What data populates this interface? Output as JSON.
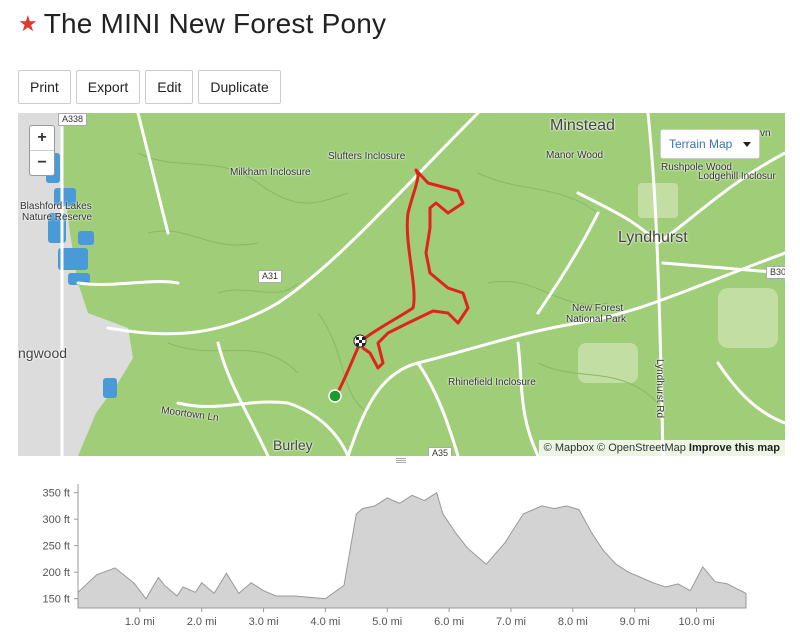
{
  "header": {
    "title": "The MINI New Forest Pony",
    "star_icon": "star-icon"
  },
  "toolbar": {
    "print": "Print",
    "export": "Export",
    "edit": "Edit",
    "duplicate": "Duplicate"
  },
  "map": {
    "zoom_in": "+",
    "zoom_out": "−",
    "layer_select": "Terrain Map",
    "attribution": {
      "mapbox": "© Mapbox",
      "osm": "© OpenStreetMap",
      "improve": "Improve this map"
    },
    "labels": {
      "minstead": "Minstead",
      "manor_wood": "Manor Wood",
      "slufters": "Slufters Inclosure",
      "milkham": "Milkham Inclosure",
      "blashford": "Blashford Lakes",
      "nature_reserve": "Nature Reserve",
      "lyndhurst": "Lyndhurst",
      "rushpole": "Rushpole Wood",
      "lodgehill": "Lodgehill Inclosur",
      "vn": "vn",
      "new_forest": "New Forest",
      "national_park": "National Park",
      "ringwood": "ngwood",
      "rhinefield": "Rhinefield Inclosure",
      "moortown": "Moortown Ln",
      "burley": "Burley",
      "lyndhurst_rd": "Lyndhurst Rd",
      "a338": "A338",
      "a31": "A31",
      "a35": "A35",
      "b30": "B30"
    },
    "colors": {
      "land": "#9fcd78",
      "route": "#e0241b",
      "start": "#1a9b2a"
    }
  },
  "elevation": {
    "y_ticks": [
      "350 ft",
      "300 ft",
      "250 ft",
      "200 ft",
      "150 ft"
    ],
    "x_ticks": [
      "1.0 mi",
      "2.0 mi",
      "3.0 mi",
      "4.0 mi",
      "5.0 mi",
      "6.0 mi",
      "7.0 mi",
      "8.0 mi",
      "9.0 mi",
      "10.0 mi"
    ]
  },
  "chart_data": {
    "type": "area",
    "x": [
      0,
      0.3,
      0.6,
      0.9,
      1.1,
      1.3,
      1.4,
      1.6,
      1.7,
      1.9,
      2.0,
      2.2,
      2.4,
      2.6,
      2.8,
      3.0,
      3.2,
      3.5,
      3.8,
      4.0,
      4.3,
      4.5,
      4.6,
      4.8,
      5.0,
      5.2,
      5.4,
      5.6,
      5.8,
      5.9,
      6.1,
      6.3,
      6.6,
      6.9,
      7.2,
      7.5,
      7.7,
      7.9,
      8.1,
      8.3,
      8.5,
      8.7,
      8.9,
      9.1,
      9.3,
      9.5,
      9.7,
      9.9,
      10.1,
      10.3,
      10.5,
      10.8
    ],
    "y": [
      162,
      195,
      208,
      180,
      150,
      190,
      175,
      155,
      172,
      162,
      180,
      160,
      198,
      160,
      180,
      165,
      155,
      155,
      152,
      150,
      175,
      310,
      320,
      325,
      340,
      330,
      345,
      335,
      350,
      310,
      275,
      245,
      215,
      255,
      310,
      325,
      320,
      325,
      318,
      275,
      240,
      215,
      200,
      190,
      180,
      172,
      178,
      165,
      210,
      182,
      178,
      160
    ],
    "ylim": [
      140,
      355
    ],
    "xlim": [
      0,
      10.8
    ]
  }
}
